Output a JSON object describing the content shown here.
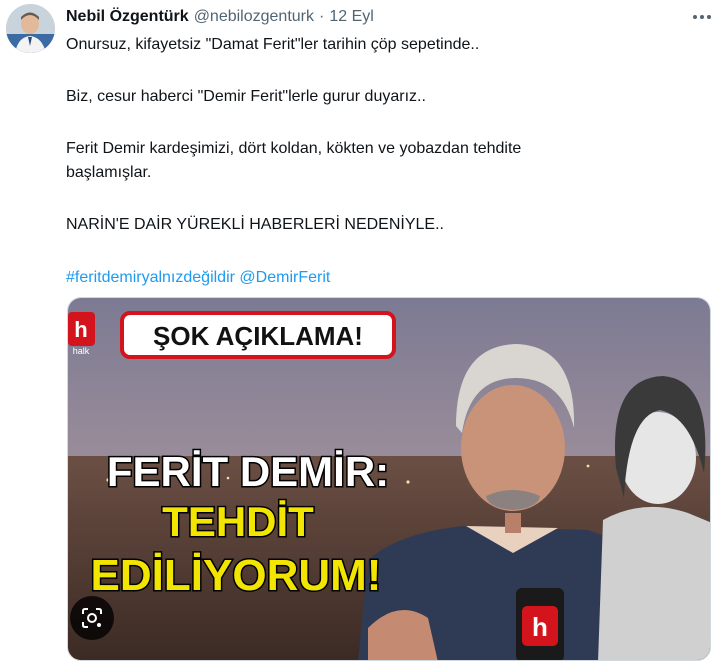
{
  "author": {
    "display_name": "Nebil Özgentürk",
    "handle": "@nebilozgenturk",
    "time": "12 Eyl"
  },
  "text": {
    "line1": "Onursuz, kifayetsiz \"Damat Ferit\"ler tarihin çöp sepetinde..",
    "line2": "Biz, cesur haberci \"Demir Ferit\"lerle gurur duyarız..",
    "line3a": "Ferit Demir kardeşimizi, dört koldan, kökten ve yobazdan tehdite",
    "line3b": "başlamışlar.",
    "line4": "NARİN'E DAİR YÜREKLİ HABERLERİ NEDENİYLE..",
    "hashtag": "#feritdemiryalnızdeğildir",
    "mention": "@DemirFerit"
  },
  "media": {
    "channel_logo": "h",
    "channel_tag": "halk",
    "banner": "ŞOK AÇIKLAMA!",
    "headline1": "FERİT DEMİR:",
    "headline2": "TEHDİT",
    "headline3": "EDİLİYORUM!",
    "mic_logo": "h"
  },
  "icons": {
    "more": "more-dots-icon",
    "lens": "google-lens-icon"
  },
  "colors": {
    "link": "#1d9bf0",
    "secondary_text": "#536471",
    "headline_yellow": "#f2e600",
    "banner_red": "#d4141c"
  }
}
